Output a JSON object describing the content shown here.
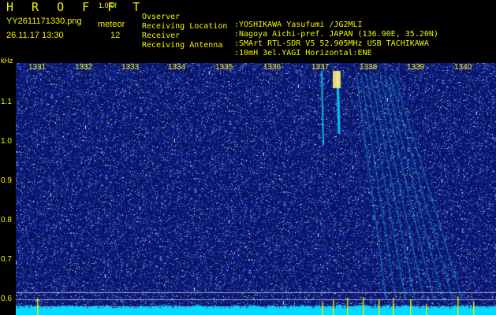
{
  "header": {
    "brand": "H R O F F T",
    "version": "1.0.0f",
    "file_name": "YY2611171330.png",
    "timestamp": "26.11.17 13:30",
    "meteor_label": "meteor",
    "meteor_count": "12"
  },
  "info": [
    {
      "label": "Ovserver",
      "value": ":YOSHIKAWA Yasufumi /JG2MLI"
    },
    {
      "label": "Receiving Location",
      "value": ":Nagoya Aichi-pref. JAPAN (136.90E, 35.20N)"
    },
    {
      "label": "Receiver",
      "value": ":SMArt RTL-SDR V5 52.905MHz USB TACHIKAWA"
    },
    {
      "label": "Receiving Antenna",
      "value": ":10mH 3el.YAGI Horizontal:ENE"
    }
  ],
  "axis": {
    "y_unit": "kHz",
    "y_ticks": [
      "1.1",
      "1.0",
      "0.9",
      "0.8",
      "0.7",
      "0.6"
    ],
    "x_ticks": [
      "1331",
      "1332",
      "1333",
      "1334",
      "1335",
      "1336",
      "1337",
      "1338",
      "1339",
      "1340"
    ]
  },
  "colors": {
    "text": "#f5f500",
    "background": "#000000",
    "noise": "#1a2a9a",
    "signal": "#00e0ff",
    "marker": "#e8e800"
  }
}
